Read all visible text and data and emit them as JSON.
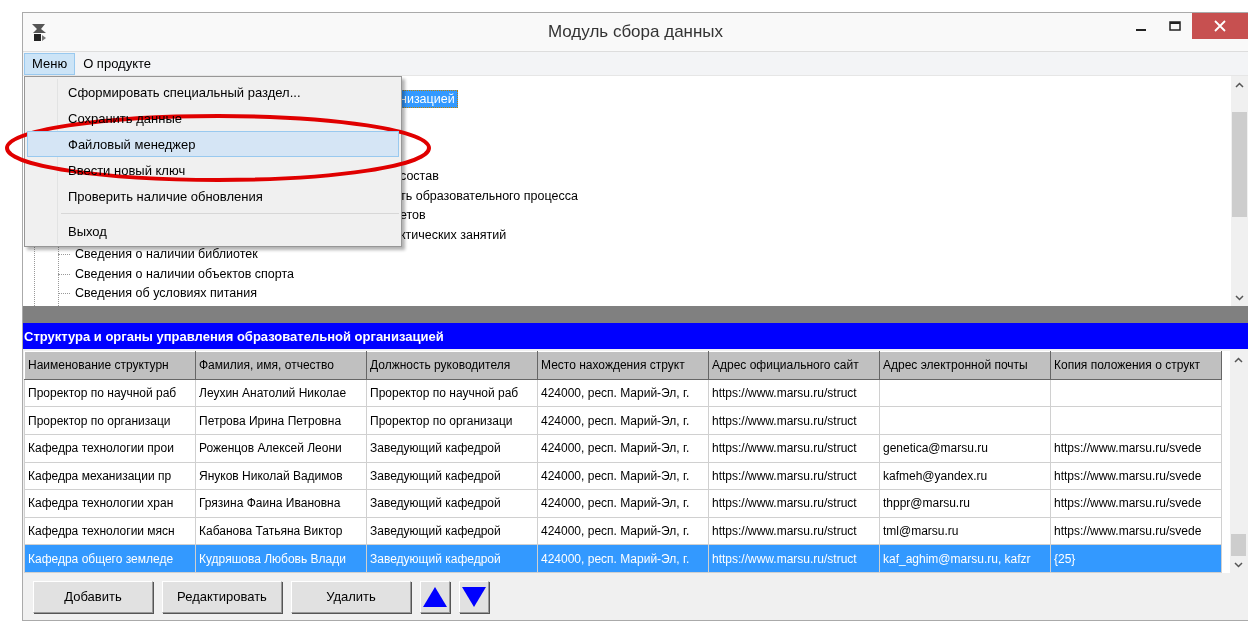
{
  "window": {
    "title": "Модуль сбора данных"
  },
  "menu_bar": [
    {
      "label": "Меню",
      "selected": true
    },
    {
      "label": "О продукте",
      "selected": false
    }
  ],
  "dropdown_menu": [
    {
      "label": "Сформировать специальный раздел...",
      "highlighted": false,
      "separator_before": false
    },
    {
      "label": "Сохранить данные",
      "highlighted": false,
      "separator_before": false
    },
    {
      "label": "Файловый менеджер",
      "highlighted": true,
      "separator_before": false
    },
    {
      "label": "Ввести новый ключ",
      "highlighted": false,
      "separator_before": false
    },
    {
      "label": "Проверить наличие обновления",
      "highlighted": false,
      "separator_before": false
    },
    {
      "label": "Выход",
      "highlighted": false,
      "separator_before": true
    }
  ],
  "tree": [
    {
      "text": "низацией",
      "kind": "partial",
      "selected": true
    },
    {
      "text": "состав",
      "kind": "partial",
      "selected": false
    },
    {
      "text": "ть образовательного процесса",
      "kind": "partial",
      "selected": false
    },
    {
      "text": "етов",
      "kind": "partial",
      "selected": false
    },
    {
      "text": "ктических занятий",
      "kind": "partial",
      "selected": false
    },
    {
      "text": "Сведения о наличии библиотек",
      "kind": "item",
      "selected": false
    },
    {
      "text": "Сведения о наличии объектов спорта",
      "kind": "item",
      "selected": false
    },
    {
      "text": "Сведения об условиях питания",
      "kind": "item",
      "selected": false
    }
  ],
  "section_title": "Структура и органы управления образовательной организацией",
  "table": {
    "columns": [
      "Наименование структурн",
      "Фамилия, имя, отчество",
      "Должность руководителя",
      "Место нахождения структ",
      "Адрес официального сайт",
      "Адрес электронной почты",
      "Копия положения о структ"
    ],
    "rows": [
      {
        "selected": false,
        "cells": [
          "Проректор по научной раб",
          "Леухин Анатолий Николае",
          "Проректор по научной раб",
          "424000, респ. Марий-Эл, г.",
          "https://www.marsu.ru/struct",
          null,
          null
        ]
      },
      {
        "selected": false,
        "cells": [
          "Проректор по организаци",
          "Петрова Ирина Петровна",
          "Проректор по организаци",
          "424000, респ. Марий-Эл, г.",
          "https://www.marsu.ru/struct",
          null,
          null
        ]
      },
      {
        "selected": false,
        "cells": [
          "Кафедра технологии прои",
          "Роженцов Алексей Леони",
          "Заведующий кафедрой",
          "424000, респ. Марий-Эл, г.",
          "https://www.marsu.ru/struct",
          "genetica@marsu.ru",
          "https://www.marsu.ru/svede"
        ]
      },
      {
        "selected": false,
        "cells": [
          "Кафедра механизации пр",
          "Януков Николай Вадимов",
          "Заведующий кафедрой",
          "424000, респ. Марий-Эл, г.",
          "https://www.marsu.ru/struct",
          "kafmeh@yandex.ru",
          "https://www.marsu.ru/svede"
        ]
      },
      {
        "selected": false,
        "cells": [
          "Кафедра технологии хран",
          "Грязина Фаина Ивановна",
          "Заведующий кафедрой",
          "424000, респ. Марий-Эл, г.",
          "https://www.marsu.ru/struct",
          "thppr@marsu.ru",
          "https://www.marsu.ru/svede"
        ]
      },
      {
        "selected": false,
        "cells": [
          "Кафедра технологии мясн",
          "Кабанова Татьяна Виктор",
          "Заведующий кафедрой",
          "424000, респ. Марий-Эл, г.",
          "https://www.marsu.ru/struct",
          "tml@marsu.ru",
          "https://www.marsu.ru/svede"
        ]
      },
      {
        "selected": true,
        "cells": [
          "Кафедра общего земледе",
          "Кудряшова Любовь Влади",
          "Заведующий кафедрой",
          "424000, респ. Марий-Эл, г.",
          "https://www.marsu.ru/struct",
          "kaf_aghim@marsu.ru, kafzr",
          "{25}"
        ]
      }
    ]
  },
  "buttons": [
    {
      "kind": "text",
      "label": "Добавить"
    },
    {
      "kind": "text",
      "label": "Редактировать"
    },
    {
      "kind": "text",
      "label": "Удалить"
    },
    {
      "kind": "up"
    },
    {
      "kind": "down"
    }
  ]
}
